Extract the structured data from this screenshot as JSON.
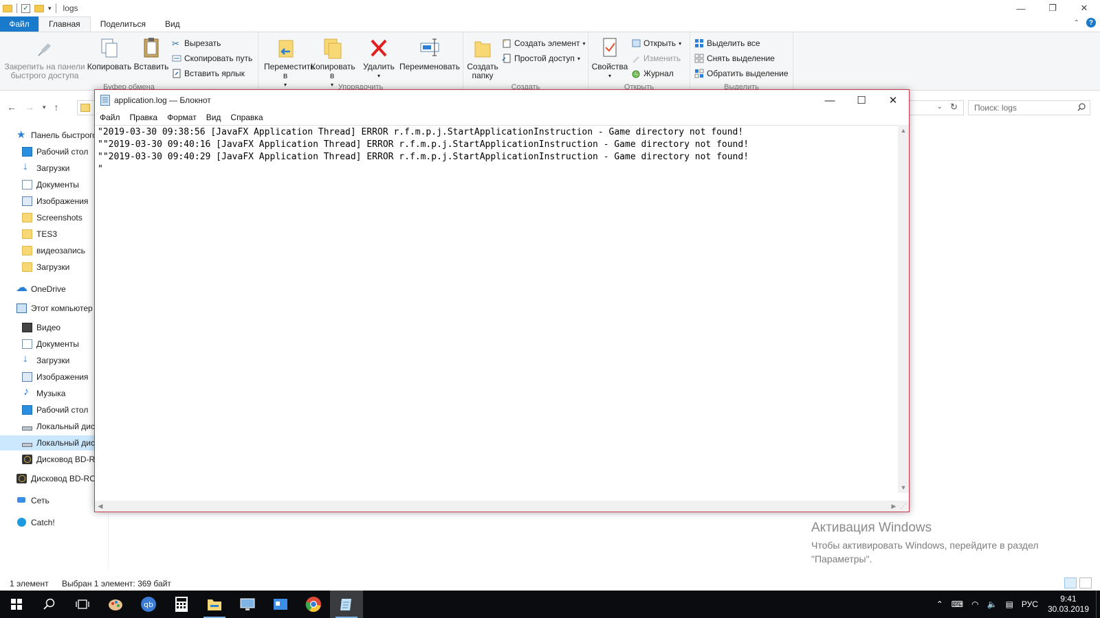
{
  "explorer": {
    "title": "logs",
    "tabs": {
      "file": "Файл",
      "home": "Главная",
      "share": "Поделиться",
      "view": "Вид"
    },
    "ribbon": {
      "pin": "Закрепить на панели быстрого доступа",
      "copy": "Копировать",
      "paste": "Вставить",
      "cut": "Вырезать",
      "copy_path": "Скопировать путь",
      "paste_shortcut": "Вставить ярлык",
      "clipboard_group": "Буфер обмена",
      "move_to": "Переместить в",
      "copy_to": "Копировать в",
      "delete": "Удалить",
      "rename": "Переименовать",
      "organize_group": "Упорядочить",
      "new_folder": "Создать папку",
      "new_item": "Создать элемент",
      "easy_access": "Простой доступ",
      "new_group": "Создать",
      "properties": "Свойства",
      "open": "Открыть",
      "edit": "Изменить",
      "history": "Журнал",
      "open_group": "Открыть",
      "select_all": "Выделить все",
      "select_none": "Снять выделение",
      "invert_selection": "Обратить выделение",
      "select_group": "Выделить"
    },
    "search_placeholder": "Поиск: logs",
    "nav": [
      {
        "label": "Панель быстрого доступа",
        "icon": "star-icon",
        "level": 1
      },
      {
        "label": "Рабочий стол",
        "icon": "desktop-icon",
        "level": 2
      },
      {
        "label": "Загрузки",
        "icon": "downloads-icon",
        "level": 2
      },
      {
        "label": "Документы",
        "icon": "documents-icon",
        "level": 2
      },
      {
        "label": "Изображения",
        "icon": "pictures-icon",
        "level": 2
      },
      {
        "label": "Screenshots",
        "icon": "folder-icon",
        "level": 2
      },
      {
        "label": "TES3",
        "icon": "folder-icon",
        "level": 2
      },
      {
        "label": "видеозапись",
        "icon": "folder-icon",
        "level": 2
      },
      {
        "label": "Загрузки",
        "icon": "folder-icon",
        "level": 2
      },
      {
        "label": "OneDrive",
        "icon": "onedrive-icon",
        "level": 1
      },
      {
        "label": "Этот компьютер",
        "icon": "computer-icon",
        "level": 1
      },
      {
        "label": "Видео",
        "icon": "videos-icon",
        "level": 2
      },
      {
        "label": "Документы",
        "icon": "documents-icon",
        "level": 2
      },
      {
        "label": "Загрузки",
        "icon": "downloads-icon",
        "level": 2
      },
      {
        "label": "Изображения",
        "icon": "pictures-icon",
        "level": 2
      },
      {
        "label": "Музыка",
        "icon": "music-icon",
        "level": 2
      },
      {
        "label": "Рабочий стол",
        "icon": "desktop-icon",
        "level": 2
      },
      {
        "label": "Локальный диск",
        "icon": "drive-icon",
        "level": 2
      },
      {
        "label": "Локальный диск",
        "icon": "drive-icon",
        "level": 2,
        "selected": true
      },
      {
        "label": "Дисковод BD-R",
        "icon": "disc-drive-icon",
        "level": 2
      },
      {
        "label": "Дисковод BD-RO",
        "icon": "disc-drive-icon",
        "level": 1
      },
      {
        "label": "Сеть",
        "icon": "network-icon",
        "level": 1
      },
      {
        "label": "Catch!",
        "icon": "catch-icon",
        "level": 1
      }
    ],
    "status": {
      "count": "1 элемент",
      "selected": "Выбран 1 элемент: 369 байт"
    }
  },
  "notepad": {
    "title": "application.log — Блокнот",
    "menu": [
      "Файл",
      "Правка",
      "Формат",
      "Вид",
      "Справка"
    ],
    "lines": [
      "\"2019-03-30 09:38:56 [JavaFX Application Thread] ERROR r.f.m.p.j.StartApplicationInstruction - Game directory not found!",
      "\"\"2019-03-30 09:40:16 [JavaFX Application Thread] ERROR r.f.m.p.j.StartApplicationInstruction - Game directory not found!",
      "\"\"2019-03-30 09:40:29 [JavaFX Application Thread] ERROR r.f.m.p.j.StartApplicationInstruction - Game directory not found!",
      "\""
    ]
  },
  "watermark": {
    "line1": "Активация Windows",
    "line2": "Чтобы активировать Windows, перейдите в раздел",
    "line3": "\"Параметры\"."
  },
  "taskbar": {
    "lang": "РУС",
    "time": "9:41",
    "date": "30.03.2019"
  }
}
